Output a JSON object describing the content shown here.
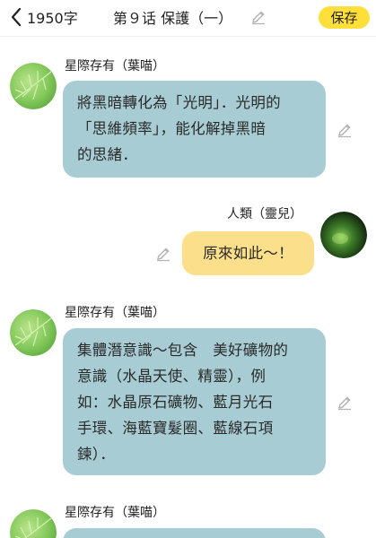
{
  "header": {
    "word_count": "1950字",
    "title": "第９话 保護（一）",
    "save_label": "保存"
  },
  "messages": [
    {
      "speaker": "星際存有（葉喵）",
      "side": "left",
      "lines": [
        "將黑暗轉化為「光明」．光明的",
        "「思維頻率」，能化解掉黑暗",
        "的思緒．"
      ]
    },
    {
      "speaker": "人類（靈兒）",
      "side": "right",
      "lines": [
        "原來如此～！"
      ]
    },
    {
      "speaker": "星際存有（葉喵）",
      "side": "left",
      "lines": [
        "集體潛意識～包含　美好礦物的",
        "意識（水晶天使、精靈），例",
        "如：水晶原石礦物、藍月光石",
        "手環、海藍寶髮圈、藍線石項",
        "鍊）．"
      ]
    },
    {
      "speaker": "星際存有（葉喵）",
      "side": "left",
      "lines": []
    }
  ],
  "colors": {
    "save_button": "#ffdf3a",
    "bubble_blue": "#a8ccd3",
    "bubble_yellow": "#fcdf8a",
    "pencil_icon": "#b5b5b5"
  },
  "icons": {
    "back": "chevron-left-icon",
    "edit": "pencil-icon"
  }
}
